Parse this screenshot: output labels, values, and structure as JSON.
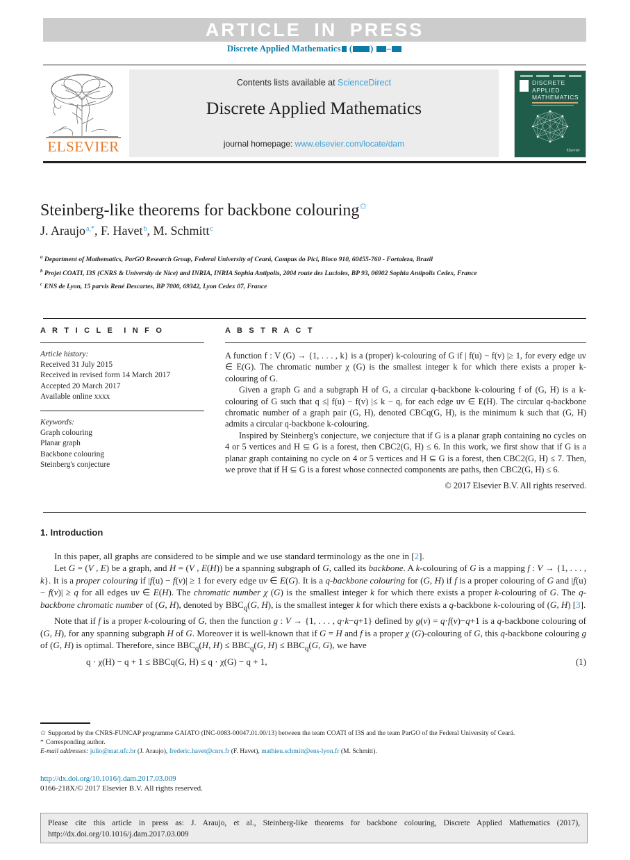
{
  "banner": {
    "text": "ARTICLE  IN  PRESS"
  },
  "running_head": {
    "journal": "Discrete Applied Mathematics"
  },
  "masthead": {
    "publisher": "ELSEVIER",
    "contents_prefix": "Contents lists available at ",
    "contents_link": "ScienceDirect",
    "journal_title": "Discrete Applied Mathematics",
    "homepage_prefix": "journal homepage: ",
    "homepage_link": "www.elsevier.com/locate/dam",
    "cover": {
      "line1": "DISCRETE",
      "line2": "APPLIED",
      "line3": "MATHEMATICS",
      "footer": "Elsevier"
    }
  },
  "article": {
    "title": "Steinberg-like theorems for backbone colouring",
    "title_footnote_marker": "✩",
    "authors": [
      {
        "name": "J. Araujo",
        "sup": "a,*"
      },
      {
        "name": "F. Havet",
        "sup": "b"
      },
      {
        "name": "M. Schmitt",
        "sup": "c"
      }
    ],
    "affiliations": [
      {
        "mark": "a",
        "text": "Department of Mathematics, ParGO Research Group, Federal University of Ceará, Campus do Pici, Bloco 910, 60455-760 - Fortaleza, Brazil"
      },
      {
        "mark": "b",
        "text": "Projet COATI, I3S (CNRS & University de Nice) and INRIA, INRIA Sophia Antipolis, 2004 route des Lucioles, BP 93, 06902 Sophia Antipolis Cedex, France"
      },
      {
        "mark": "c",
        "text": "ENS de Lyon, 15 parvis René Descartes, BP 7000, 69342, Lyon Cedex 07, France"
      }
    ]
  },
  "info": {
    "heading": "ARTICLE INFO",
    "history_label": "Article history:",
    "history": [
      "Received 31 July 2015",
      "Received in revised form 14 March 2017",
      "Accepted 20 March 2017",
      "Available online xxxx"
    ],
    "keywords_label": "Keywords:",
    "keywords": [
      "Graph colouring",
      "Planar graph",
      "Backbone colouring",
      "Steinberg's conjecture"
    ]
  },
  "abstract": {
    "heading": "ABSTRACT",
    "paragraph1": "A function f : V (G) → {1, . . . , k} is a (proper) k-colouring of G if | f(u) − f(v) |≥ 1, for every edge uv ∈ E(G). The chromatic number χ (G) is the smallest integer k for which there exists a proper k-colouring of G.",
    "paragraph2": "Given a graph G and a subgraph H of G, a circular q-backbone k-colouring f of (G, H) is a k-colouring of G such that q ≤| f(u) − f(v) |≤ k − q, for each edge uv ∈ E(H). The circular q-backbone chromatic number of a graph pair (G, H), denoted CBCq(G, H), is the minimum k such that (G, H) admits a circular q-backbone k-colouring.",
    "paragraph3": "Inspired by Steinberg's conjecture, we conjecture that if G is a planar graph containing no cycles on 4 or 5 vertices and H ⊆ G is a forest, then CBC2(G, H) ≤ 6. In this work, we first show that if G is a planar graph containing no cycle on 4 or 5 vertices and H ⊆ G is a forest, then CBC2(G, H) ≤ 7. Then, we prove that if H ⊆ G is a forest whose connected components are paths, then CBC2(G, H) ≤ 6.",
    "copyright": "© 2017 Elsevier B.V. All rights reserved."
  },
  "body": {
    "section_number": "1.",
    "section_title": "Introduction",
    "para1": "In this paper, all graphs are considered to be simple and we use standard terminology as the one in [2].",
    "para2": "Let G = (V , E) be a graph, and H = (V , E(H)) be a spanning subgraph of G, called its backbone. A k-colouring of G is a mapping f : V → {1, . . . , k}. It is a proper colouring if |f(u) − f(v)| ≥ 1 for every edge uv ∈ E(G). It is a q-backbone colouring for (G, H) if f is a proper colouring of G and |f(u) − f(v)| ≥ q for all edges uv ∈ E(H). The chromatic number χ (G) is the smallest integer k for which there exists a proper k-colouring of G. The q-backbone chromatic number of (G, H), denoted by BBCq(G, H), is the smallest integer k for which there exists a q-backbone k-colouring of (G, H) [3].",
    "para3": "Note that if f is a proper k-colouring of G, then the function g : V → {1, . . . , q·k−q+1} defined by g(v) = q·f(v)−q+1 is a q-backbone colouring of (G, H), for any spanning subgraph H of G. Moreover it is well-known that if G = H and f is a proper χ (G)-colouring of G, this q-backbone colouring g of (G, H) is optimal. Therefore, since BBCq(H, H) ≤ BBCq(G, H) ≤ BBCq(G, G), we have",
    "equation": "q · χ(H) − q + 1 ≤ BBCq(G, H) ≤ q · χ(G) − q + 1,",
    "equation_number": "(1)",
    "reference_2": "2",
    "reference_3": "3"
  },
  "footnotes": {
    "funding_mark": "✩",
    "funding": "Supported by the CNRS-FUNCAP programme GAIATO (INC-0083-00047.01.00/13) between the team COATI of I3S and the team ParGO of the Federal University of Ceará.",
    "corresponding_mark": "*",
    "corresponding": "Corresponding author.",
    "email_label": "E-mail addresses:",
    "emails": [
      {
        "address": "julio@mat.ufc.br",
        "person": "(J. Araujo),"
      },
      {
        "address": "frederic.havet@cnrs.fr",
        "person": "(F. Havet),"
      },
      {
        "address": "mathieu.schmitt@ens-lyon.fr",
        "person": "(M. Schmitt)."
      }
    ],
    "doi": "http://dx.doi.org/10.1016/j.dam.2017.03.009",
    "issn": "0166-218X/© 2017 Elsevier B.V. All rights reserved."
  },
  "cite_box": {
    "line1": "Please cite this article in press as: J. Araujo, et al., Steinberg-like theorems for backbone colouring, Discrete Applied Mathematics (2017),",
    "line2": "http://dx.doi.org/10.1016/j.dam.2017.03.009"
  }
}
